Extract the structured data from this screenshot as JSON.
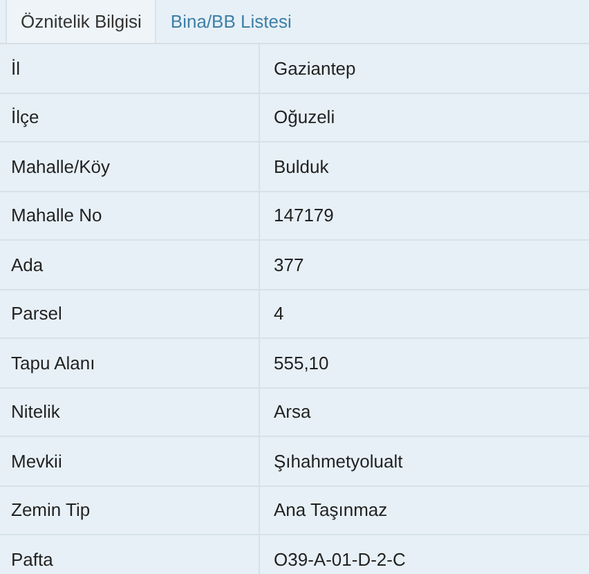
{
  "tabs": [
    {
      "label": "Öznitelik Bilgisi",
      "selected": true
    },
    {
      "label": "Bina/BB Listesi",
      "selected": false
    }
  ],
  "rows": [
    {
      "label": "İl",
      "value": "Gaziantep"
    },
    {
      "label": "İlçe",
      "value": "Oğuzeli"
    },
    {
      "label": "Mahalle/Köy",
      "value": "Bulduk"
    },
    {
      "label": "Mahalle No",
      "value": "147179"
    },
    {
      "label": "Ada",
      "value": "377"
    },
    {
      "label": "Parsel",
      "value": "4"
    },
    {
      "label": "Tapu Alanı",
      "value": "555,10"
    },
    {
      "label": "Nitelik",
      "value": "Arsa"
    },
    {
      "label": "Mevkii",
      "value": "Şıhahmetyolualt"
    },
    {
      "label": "Zemin Tip",
      "value": "Ana Taşınmaz"
    },
    {
      "label": "Pafta",
      "value": "O39-A-01-D-2-C"
    }
  ]
}
